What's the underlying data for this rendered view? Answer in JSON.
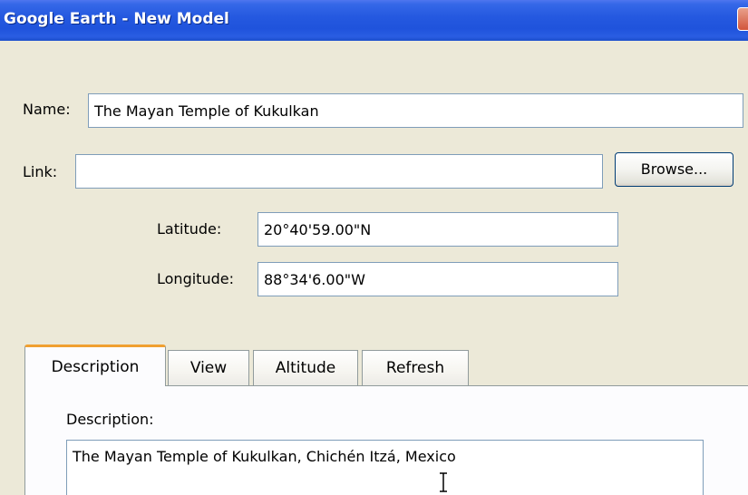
{
  "window": {
    "title": "Google Earth - New Model"
  },
  "form": {
    "name_label": "Name:",
    "name_value": "The Mayan Temple of Kukulkan",
    "link_label": "Link:",
    "link_value": "",
    "browse_label": "Browse...",
    "latitude_label": "Latitude:",
    "latitude_value": "20°40'59.00\"N",
    "longitude_label": "Longitude:",
    "longitude_value": "88°34'6.00\"W"
  },
  "tabs": [
    {
      "label": "Description",
      "active": true
    },
    {
      "label": "View",
      "active": false
    },
    {
      "label": "Altitude",
      "active": false
    },
    {
      "label": "Refresh",
      "active": false
    }
  ],
  "description_panel": {
    "label": "Description:",
    "text": "The Mayan Temple of Kukulkan, Chichén Itzá, Mexico"
  },
  "colors": {
    "titlebar": "#2559e0",
    "window_bg": "#ece9d8",
    "active_tab_accent": "#f0a030",
    "field_border": "#7f9db9"
  },
  "icons": {
    "close": "close-icon",
    "cursor": "text-cursor-icon"
  }
}
